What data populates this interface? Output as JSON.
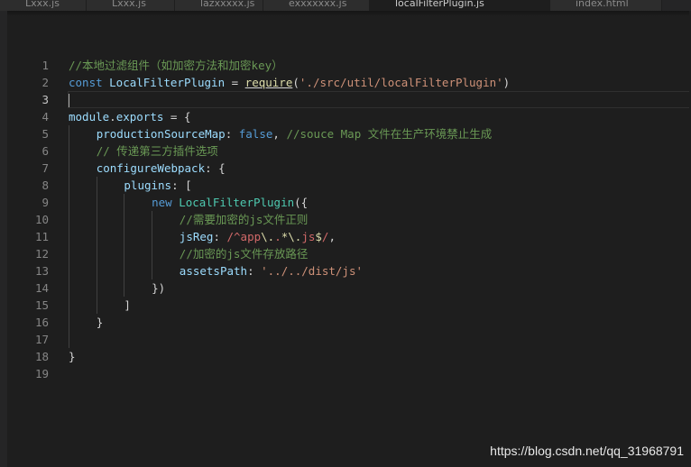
{
  "tabs": [
    {
      "label": "Lxxx.js",
      "active": false
    },
    {
      "label": "Lxxx.js",
      "active": false
    },
    {
      "label": "lazxxxxx.js",
      "active": false
    },
    {
      "label": "exxxxxxx.js",
      "active": false
    },
    {
      "label": "localFilterPlugin.js",
      "active": true
    },
    {
      "label": "index.html",
      "active": false
    }
  ],
  "editor": {
    "current_line": 3,
    "lines": [
      {
        "n": "1",
        "indent": 0,
        "tokens": [
          {
            "t": "comment",
            "v": "//本地过滤组件（如加密方法和加密key）"
          }
        ]
      },
      {
        "n": "2",
        "indent": 0,
        "tokens": [
          {
            "t": "keyword",
            "v": "const "
          },
          {
            "t": "var",
            "v": "LocalFilterPlugin"
          },
          {
            "t": "plain",
            "v": " = "
          },
          {
            "t": "func",
            "v": "require",
            "u": true
          },
          {
            "t": "plain",
            "v": "("
          },
          {
            "t": "string",
            "v": "'./src/util/localFilterPlugin'"
          },
          {
            "t": "plain",
            "v": ")"
          }
        ]
      },
      {
        "n": "3",
        "indent": 0,
        "cursor": true,
        "tokens": []
      },
      {
        "n": "4",
        "indent": 0,
        "tokens": [
          {
            "t": "var",
            "v": "module"
          },
          {
            "t": "plain",
            "v": "."
          },
          {
            "t": "var",
            "v": "exports"
          },
          {
            "t": "plain",
            "v": " = {"
          }
        ]
      },
      {
        "n": "5",
        "indent": 1,
        "tokens": [
          {
            "t": "var",
            "v": "productionSourceMap"
          },
          {
            "t": "plain",
            "v": ": "
          },
          {
            "t": "keyword",
            "v": "false"
          },
          {
            "t": "plain",
            "v": ", "
          },
          {
            "t": "comment",
            "v": "//souce Map 文件在生产环境禁止生成"
          }
        ]
      },
      {
        "n": "6",
        "indent": 1,
        "tokens": [
          {
            "t": "comment",
            "v": "// 传递第三方插件选项"
          }
        ]
      },
      {
        "n": "7",
        "indent": 1,
        "tokens": [
          {
            "t": "var",
            "v": "configureWebpack"
          },
          {
            "t": "plain",
            "v": ": {"
          }
        ]
      },
      {
        "n": "8",
        "indent": 2,
        "tokens": [
          {
            "t": "var",
            "v": "plugins"
          },
          {
            "t": "plain",
            "v": ": ["
          }
        ]
      },
      {
        "n": "9",
        "indent": 3,
        "tokens": [
          {
            "t": "keyword",
            "v": "new "
          },
          {
            "t": "class",
            "v": "LocalFilterPlugin"
          },
          {
            "t": "plain",
            "v": "({"
          }
        ]
      },
      {
        "n": "10",
        "indent": 4,
        "tokens": [
          {
            "t": "comment",
            "v": "//需要加密的js文件正则"
          }
        ]
      },
      {
        "n": "11",
        "indent": 4,
        "tokens": [
          {
            "t": "var",
            "v": "jsReg"
          },
          {
            "t": "plain",
            "v": ": "
          },
          {
            "t": "regex",
            "v": "/^app"
          },
          {
            "t": "regexop",
            "v": "\\."
          },
          {
            "t": "regex",
            "v": "."
          },
          {
            "t": "regexop",
            "v": "*\\."
          },
          {
            "t": "regex",
            "v": "js"
          },
          {
            "t": "regexop",
            "v": "$"
          },
          {
            "t": "regex",
            "v": "/"
          },
          {
            "t": "plain",
            "v": ","
          }
        ]
      },
      {
        "n": "12",
        "indent": 4,
        "tokens": [
          {
            "t": "comment",
            "v": "//加密的js文件存放路径"
          }
        ]
      },
      {
        "n": "13",
        "indent": 4,
        "tokens": [
          {
            "t": "var",
            "v": "assetsPath"
          },
          {
            "t": "plain",
            "v": ": "
          },
          {
            "t": "string",
            "v": "'../../dist/js'"
          }
        ]
      },
      {
        "n": "14",
        "indent": 3,
        "tokens": [
          {
            "t": "plain",
            "v": "})"
          }
        ]
      },
      {
        "n": "15",
        "indent": 2,
        "tokens": [
          {
            "t": "plain",
            "v": "]"
          }
        ]
      },
      {
        "n": "16",
        "indent": 1,
        "tokens": [
          {
            "t": "plain",
            "v": "}"
          }
        ]
      },
      {
        "n": "17",
        "indent": 0,
        "guides": 1,
        "tokens": []
      },
      {
        "n": "18",
        "indent": 0,
        "tokens": [
          {
            "t": "plain",
            "v": "}"
          }
        ]
      },
      {
        "n": "19",
        "indent": 0,
        "tokens": []
      }
    ]
  },
  "watermark": "https://blog.csdn.net/qq_31968791",
  "colors": {
    "background": "#1e1e1e",
    "comment": "#6a9955",
    "keyword": "#569cd6",
    "variable": "#9cdcfe",
    "function": "#dcdcaa",
    "class": "#4ec9b0",
    "string": "#ce9178",
    "regex": "#d16969"
  }
}
